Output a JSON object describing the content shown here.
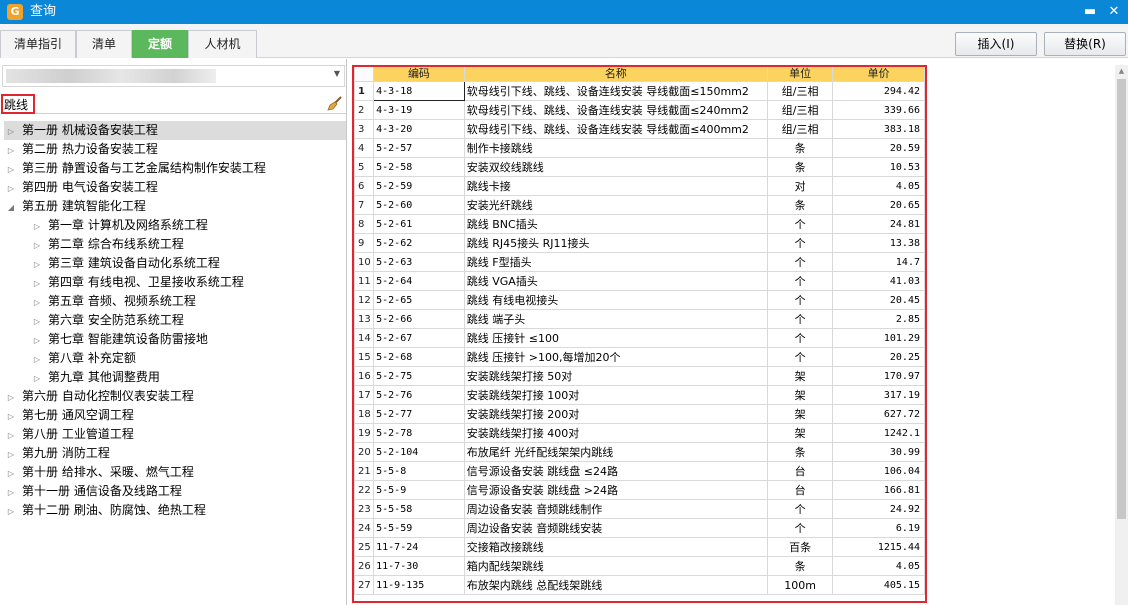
{
  "window": {
    "title": "查询",
    "app_icon_glyph": "G"
  },
  "tabs": [
    "清单指引",
    "清单",
    "定额",
    "人材机"
  ],
  "active_tab": 2,
  "buttons": {
    "insert": "插入(I)",
    "replace": "替换(R)"
  },
  "search": {
    "value": "跳线"
  },
  "tree": [
    {
      "label": "第一册 机械设备安装工程",
      "level": 0,
      "expanded": false,
      "selected": true
    },
    {
      "label": "第二册 热力设备安装工程",
      "level": 0,
      "expanded": false
    },
    {
      "label": "第三册 静置设备与工艺金属结构制作安装工程",
      "level": 0,
      "expanded": false
    },
    {
      "label": "第四册 电气设备安装工程",
      "level": 0,
      "expanded": false
    },
    {
      "label": "第五册 建筑智能化工程",
      "level": 0,
      "expanded": true
    },
    {
      "label": "第一章 计算机及网络系统工程",
      "level": 1,
      "expanded": false
    },
    {
      "label": "第二章 综合布线系统工程",
      "level": 1,
      "expanded": false
    },
    {
      "label": "第三章 建筑设备自动化系统工程",
      "level": 1,
      "expanded": false
    },
    {
      "label": "第四章 有线电视、卫星接收系统工程",
      "level": 1,
      "expanded": false
    },
    {
      "label": "第五章 音频、视频系统工程",
      "level": 1,
      "expanded": false
    },
    {
      "label": "第六章 安全防范系统工程",
      "level": 1,
      "expanded": false
    },
    {
      "label": "第七章 智能建筑设备防雷接地",
      "level": 1,
      "expanded": false
    },
    {
      "label": "第八章 补充定额",
      "level": 1,
      "expanded": false
    },
    {
      "label": "第九章 其他调整费用",
      "level": 1,
      "expanded": false
    },
    {
      "label": "第六册 自动化控制仪表安装工程",
      "level": 0,
      "expanded": false
    },
    {
      "label": "第七册 通风空调工程",
      "level": 0,
      "expanded": false
    },
    {
      "label": "第八册 工业管道工程",
      "level": 0,
      "expanded": false
    },
    {
      "label": "第九册 消防工程",
      "level": 0,
      "expanded": false
    },
    {
      "label": "第十册 给排水、采暖、燃气工程",
      "level": 0,
      "expanded": false
    },
    {
      "label": "第十一册 通信设备及线路工程",
      "level": 0,
      "expanded": false
    },
    {
      "label": "第十二册 刷油、防腐蚀、绝热工程",
      "level": 0,
      "expanded": false
    }
  ],
  "grid": {
    "headers": [
      "编码",
      "名称",
      "单位",
      "单价"
    ],
    "current_row": 1,
    "rows": [
      [
        "4-3-18",
        "软母线引下线、跳线、设备连线安装 导线截面≤150mm2",
        "组/三相",
        "294.42"
      ],
      [
        "4-3-19",
        "软母线引下线、跳线、设备连线安装 导线截面≤240mm2",
        "组/三相",
        "339.66"
      ],
      [
        "4-3-20",
        "软母线引下线、跳线、设备连线安装 导线截面≤400mm2",
        "组/三相",
        "383.18"
      ],
      [
        "5-2-57",
        "制作卡接跳线",
        "条",
        "20.59"
      ],
      [
        "5-2-58",
        "安装双绞线跳线",
        "条",
        "10.53"
      ],
      [
        "5-2-59",
        "跳线卡接",
        "对",
        "4.05"
      ],
      [
        "5-2-60",
        "安装光纤跳线",
        "条",
        "20.65"
      ],
      [
        "5-2-61",
        "跳线 BNC插头",
        "个",
        "24.81"
      ],
      [
        "5-2-62",
        "跳线 RJ45接头 RJ11接头",
        "个",
        "13.38"
      ],
      [
        "5-2-63",
        "跳线 F型插头",
        "个",
        "14.7"
      ],
      [
        "5-2-64",
        "跳线 VGA插头",
        "个",
        "41.03"
      ],
      [
        "5-2-65",
        "跳线 有线电视接头",
        "个",
        "20.45"
      ],
      [
        "5-2-66",
        "跳线 端子头",
        "个",
        "2.85"
      ],
      [
        "5-2-67",
        "跳线 压接针 ≤100",
        "个",
        "101.29"
      ],
      [
        "5-2-68",
        "跳线 压接针 >100,每增加20个",
        "个",
        "20.25"
      ],
      [
        "5-2-75",
        "安装跳线架打接 50对",
        "架",
        "170.97"
      ],
      [
        "5-2-76",
        "安装跳线架打接 100对",
        "架",
        "317.19"
      ],
      [
        "5-2-77",
        "安装跳线架打接 200对",
        "架",
        "627.72"
      ],
      [
        "5-2-78",
        "安装跳线架打接 400对",
        "架",
        "1242.1"
      ],
      [
        "5-2-104",
        "布放尾纤 光纤配线架架内跳线",
        "条",
        "30.99"
      ],
      [
        "5-5-8",
        "信号源设备安装 跳线盘 ≤24路",
        "台",
        "106.04"
      ],
      [
        "5-5-9",
        "信号源设备安装 跳线盘 >24路",
        "台",
        "166.81"
      ],
      [
        "5-5-58",
        "周边设备安装 音频跳线制作",
        "个",
        "24.92"
      ],
      [
        "5-5-59",
        "周边设备安装 音频跳线安装",
        "个",
        "6.19"
      ],
      [
        "11-7-24",
        "交接箱改接跳线",
        "百条",
        "1215.44"
      ],
      [
        "11-7-30",
        "箱内配线架跳线",
        "条",
        "4.05"
      ],
      [
        "11-9-135",
        "布放架内跳线 总配线架跳线",
        "100m",
        "405.15"
      ]
    ]
  },
  "colors": {
    "titlebar": "#0a87d6",
    "active_tab": "#5cb85c",
    "header": "#fbd35e",
    "highlight": "#e0262e"
  }
}
